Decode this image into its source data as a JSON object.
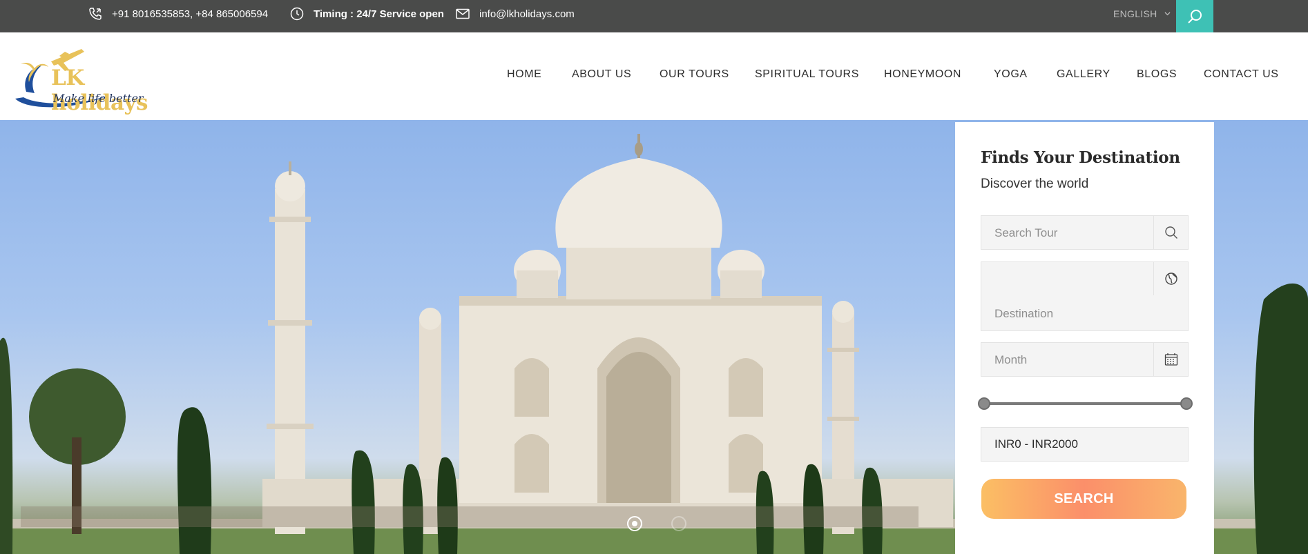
{
  "topbar": {
    "phone": "+91 8016535853, +84 865006594",
    "timing": "Timing : 24/7 Service open",
    "email": "info@lkholidays.com",
    "language": "ENGLISH",
    "icons": {
      "phone": "phone-icon",
      "clock": "clock-icon",
      "mail": "mail-icon",
      "search": "search-icon",
      "dropdown": "chevron-down-icon"
    }
  },
  "header": {
    "logo_title": "LK holidays",
    "logo_tagline": "Make life better",
    "nav": [
      "HOME",
      "ABOUT US",
      "OUR TOURS",
      "SPIRITUAL TOURS",
      "HONEYMOON",
      "YOGA",
      "GALLERY",
      "BLOGS",
      "CONTACT US"
    ]
  },
  "search_panel": {
    "title": "Finds Your Destination",
    "subtitle": "Discover the world",
    "search_placeholder": "Search Tour",
    "destination_placeholder": "Destination",
    "month_placeholder": "Month",
    "price_range": {
      "min": 0,
      "max": 2000,
      "low_fraction": 0,
      "high_fraction": 1
    },
    "price_text": "INR0 - INR2000",
    "search_button": "SEARCH"
  },
  "colors": {
    "topbar_bg": "#4a4b4a",
    "accent": "#3ec1b5",
    "logo_gold": "#e8c25a",
    "button_gradient": [
      "#fbbf64",
      "#fb8f6a"
    ]
  },
  "slider": {
    "active_slide": 1,
    "total_slides": 2
  }
}
